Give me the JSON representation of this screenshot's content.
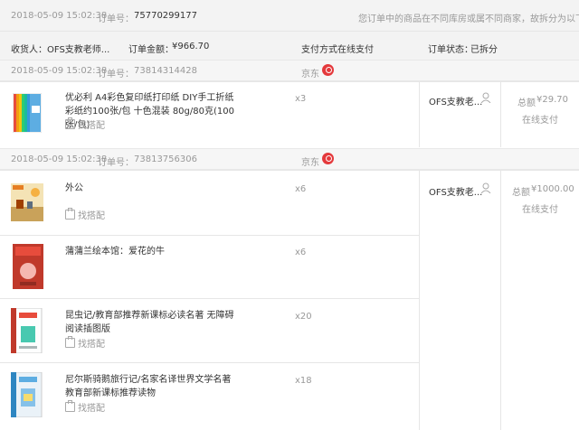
{
  "order": {
    "datetime": "2018-05-09 15:02:38",
    "order_no_label": "订单号：",
    "order_no": "75770299177",
    "split_notice": "您订单中的商品在不同库房或属不同商家，故拆分为以下订单",
    "receiver_label": "收货人：",
    "receiver": "OFS支教老师...",
    "amount_label": "订单金额：",
    "amount": "¥966.70",
    "pay_label": "支付方式",
    "pay_method": "在线支付",
    "status_label": "订单状态：",
    "status": "已拆分"
  },
  "suborders": [
    {
      "datetime": "2018-05-09 15:02:38",
      "order_no_label": "订单号：",
      "order_no": "73814314428",
      "shop": "京东",
      "recipient": "OFS支教老...",
      "total_label": "总额",
      "total": "¥29.70",
      "pay": "在线支付",
      "items": [
        {
          "name": "优必利 A4彩色复印纸打印纸 DIY手工折纸 彩纸约100张/包 十色混装 80g/80克(100张/包)",
          "qty": "x3",
          "match": "找搭配"
        }
      ]
    },
    {
      "datetime": "2018-05-09 15:02:38",
      "order_no_label": "订单号：",
      "order_no": "73813756306",
      "shop": "京东",
      "recipient": "OFS支教老...",
      "total_label": "总额",
      "total": "¥1000.00",
      "pay": "在线支付",
      "items": [
        {
          "name": "外公",
          "qty": "x6",
          "match": "找搭配"
        },
        {
          "name": "蒲蒲兰绘本馆：爱花的牛",
          "qty": "x6",
          "match": ""
        },
        {
          "name": "昆虫记/教育部推荐新课标必读名著 无障碍阅读插图版",
          "qty": "x20",
          "match": "找搭配"
        },
        {
          "name": "尼尔斯骑鹅旅行记/名家名译世界文学名著 教育部新课标推荐读物",
          "qty": "x18",
          "match": "找搭配"
        }
      ]
    }
  ],
  "colors": {
    "jd_red": "#e4393c",
    "header_bg": "#f3f3f3"
  }
}
